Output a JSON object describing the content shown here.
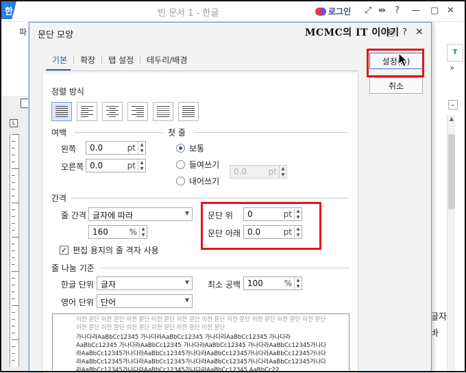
{
  "window": {
    "title": "빈 문서 1 - 한글",
    "logo": "한",
    "login": "로그인",
    "menu_file": "파",
    "right_tool_icon": "T"
  },
  "document_fragments": [
    "글자",
    "바"
  ],
  "dialog": {
    "title": "문단 모양",
    "watermark": "MCMC의 IT 이야기",
    "help": "?",
    "close": "✕",
    "tabs": [
      {
        "label": "기본",
        "active": true
      },
      {
        "label": "확장",
        "active": false
      },
      {
        "label": "탭 설정",
        "active": false
      },
      {
        "label": "테두리/배경",
        "active": false
      }
    ],
    "alignment": {
      "label": "정렬 방식",
      "selected": "justify",
      "options": [
        "justify",
        "left",
        "center",
        "right",
        "distribute",
        "divide"
      ]
    },
    "margins": {
      "label": "여백",
      "left_label": "왼쪽",
      "left_value": "0.0",
      "right_label": "오른쪽",
      "right_value": "0.0",
      "unit": "pt"
    },
    "first_line": {
      "label": "첫 줄",
      "options": [
        {
          "label": "보통",
          "selected": true
        },
        {
          "label": "들여쓰기",
          "selected": false
        },
        {
          "label": "내어쓰기",
          "selected": false
        }
      ],
      "value": "0.0",
      "unit": "pt"
    },
    "spacing": {
      "label": "간격",
      "line_spacing_label": "줄 간격",
      "line_spacing_type": "글자에 따라",
      "line_spacing_value": "160",
      "line_spacing_unit": "%",
      "para_above_label": "문단 위",
      "para_above_value": "0",
      "para_below_label": "문단 아래",
      "para_below_value": "0.0",
      "unit": "pt",
      "grid_checkbox_label": "편집 용지의 줄 격자 사용",
      "grid_checked": true
    },
    "line_break": {
      "label": "줄 나눔 기준",
      "hangul_label": "한글 단위",
      "hangul_value": "글자",
      "english_label": "영어 단위",
      "english_value": "단어",
      "min_space_label": "최소 공백",
      "min_space_value": "100",
      "min_space_unit": "%"
    },
    "preview": {
      "prev_lines": [
        "이전 문단 이전 문단 이전 문단 이전 문단 이전 문단 이전 문단 이전 문단 이전 문단 이전 문단 이전 문단 이전 문단 이전 문단 이전 문단 이전 문단 이전 문단 이전 문단"
      ],
      "current_lines": [
        "가나다라AaBbCc12345     가나다라AaBbCc12345     가나다라AaBbCc12345     가나다라AaBbCc12345 가나다라AaBbCc12345     가나다라AaBbCc12345     가나다라AaBbCc12345가나다라AaBbCc12345가나다라AaBbCc12345가나다라AaBbCc12345가나다라AaBbCc12345가나다라AaBbCc12345가나다라AaBbCc12345가나다라AaBbCc12345가나다라AaBbCc12345가나다라AaBbCc12345가나다라AaBbCc12345가나다라AaBbCc12345 AaBbCc22"
      ]
    },
    "buttons": {
      "ok": "설정(D)",
      "cancel": "취소"
    }
  },
  "highlight_color": "#e0141e",
  "accent_color": "#2b62b8"
}
